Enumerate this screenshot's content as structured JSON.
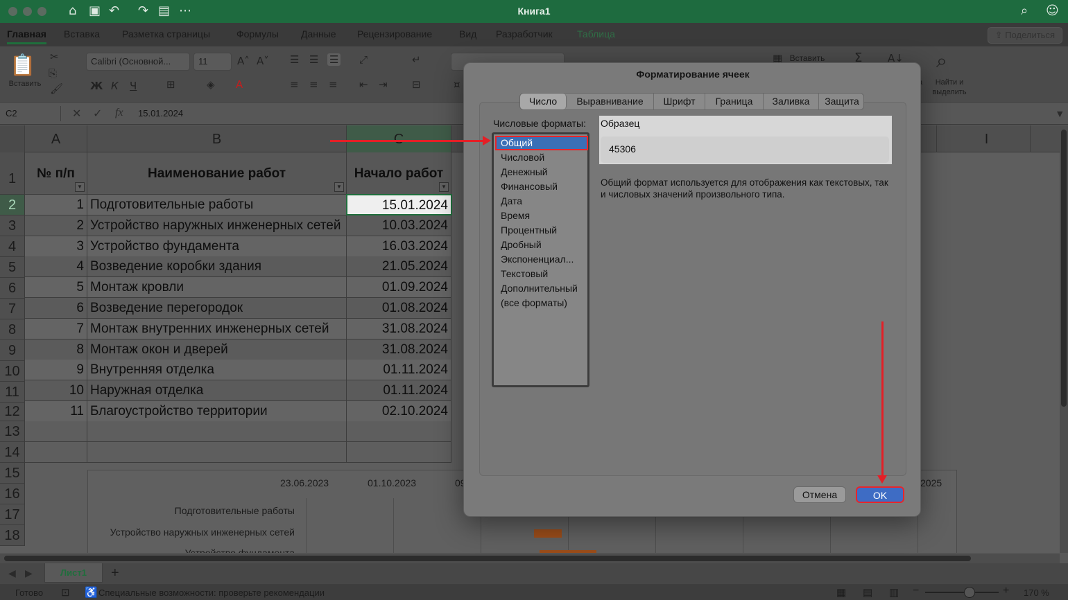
{
  "window": {
    "title": "Книга1"
  },
  "ribbon_tabs": [
    "Главная",
    "Вставка",
    "Разметка страницы",
    "Формулы",
    "Данные",
    "Рецензирование",
    "Вид",
    "Разработчик",
    "Таблица"
  ],
  "share_label": "Поделиться",
  "ribbon": {
    "paste_label": "Вставить",
    "font_name": "Calibri (Основной...",
    "font_size": "11",
    "bold": "Ж",
    "italic": "К",
    "underline": "Ч",
    "insert_label": "Вставить",
    "find_label_line1": "Найти и",
    "find_label_line2": "выделить",
    "partial_label": "а"
  },
  "formula_bar": {
    "cell_ref": "C2",
    "fx": "fx",
    "value": "15.01.2024"
  },
  "columns": [
    "A",
    "B",
    "C",
    "I"
  ],
  "table": {
    "headers": [
      "№ п/п",
      "Наименование работ",
      "Начало работ"
    ],
    "rows": [
      [
        "1",
        "Подготовительные работы",
        "15.01.2024"
      ],
      [
        "2",
        "Устройство наружных инженерных сетей",
        "10.03.2024"
      ],
      [
        "3",
        "Устройство фундамента",
        "16.03.2024"
      ],
      [
        "4",
        "Возведение коробки здания",
        "21.05.2024"
      ],
      [
        "5",
        "Монтаж кровли",
        "01.09.2024"
      ],
      [
        "6",
        "Возведение перегородок",
        "01.08.2024"
      ],
      [
        "7",
        "Монтаж внутренних инженерных сетей",
        "31.08.2024"
      ],
      [
        "8",
        "Монтаж окон и дверей",
        "31.08.2024"
      ],
      [
        "9",
        "Внутренняя отделка",
        "01.11.2024"
      ],
      [
        "10",
        "Наружная отделка",
        "01.11.2024"
      ],
      [
        "11",
        "Благоустройство территории",
        "02.10.2024"
      ]
    ]
  },
  "row_numbers": [
    "1",
    "2",
    "3",
    "4",
    "5",
    "6",
    "7",
    "8",
    "9",
    "10",
    "11",
    "12",
    "13",
    "14",
    "15",
    "16",
    "17",
    "18"
  ],
  "chart": {
    "dates": [
      "23.06.2023",
      "01.10.2023",
      "09",
      "2025"
    ],
    "categories": [
      "Подготовительные работы",
      "Устройство наружных инженерных сетей",
      "Устройство фундамента"
    ]
  },
  "sheet_tab": "Лист1",
  "status": {
    "ready": "Готово",
    "accessibility": "Специальные возможности: проверьте рекомендации",
    "zoom": "170 %"
  },
  "dialog": {
    "title": "Форматирование ячеек",
    "tabs": [
      "Число",
      "Выравнивание",
      "Шрифт",
      "Граница",
      "Заливка",
      "Защита"
    ],
    "formats_label": "Числовые форматы:",
    "formats": [
      "Общий",
      "Числовой",
      "Денежный",
      "Финансовый",
      "Дата",
      "Время",
      "Процентный",
      "Дробный",
      "Экспоненциал...",
      "Текстовый",
      "Дополнительный",
      "(все форматы)"
    ],
    "sample_label": "Образец",
    "sample_value": "45306",
    "description": "Общий формат используется для отображения как текстовых, так и числовых значений произвольного типа.",
    "cancel": "Отмена",
    "ok": "OK"
  },
  "colors": {
    "excel_green": "#1e6b3f",
    "annotation_red": "#e41f26",
    "selection_blue": "#3b6fb6"
  }
}
